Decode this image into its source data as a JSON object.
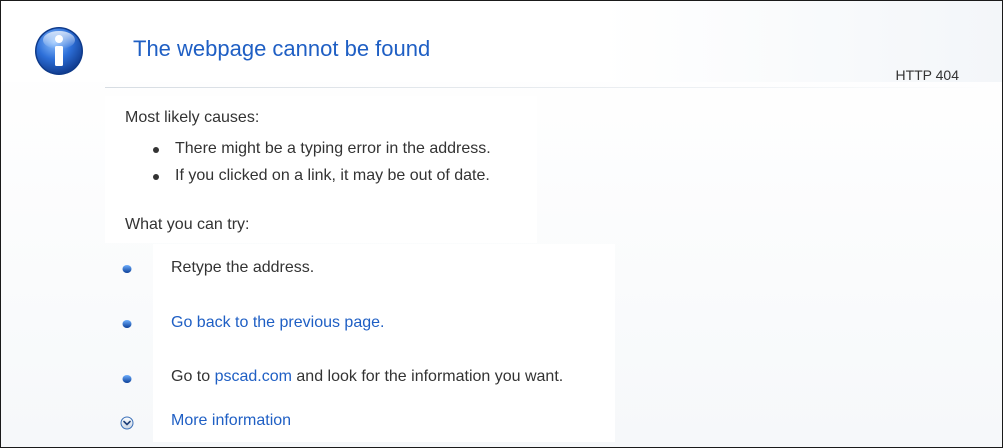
{
  "header": {
    "title": "The webpage cannot be found",
    "status_code": "HTTP 404"
  },
  "causes": {
    "heading": "Most likely causes:",
    "items": [
      "There might be a typing error in the address.",
      "If you clicked on a link, it may be out of date."
    ]
  },
  "try": {
    "heading": "What you can try:",
    "retype": "Retype the address.",
    "go_back_link": "Go back to the previous page.",
    "goto_prefix": "Go to ",
    "site_link": "pscad.com",
    "goto_suffix": " and look for the information you want.",
    "more_info": "More information"
  },
  "colors": {
    "link": "#1f5fc4",
    "text": "#333333",
    "icon_blue": "#2a6fd6"
  },
  "icons": {
    "header": "info-icon",
    "bullet": "blue-bullet-icon",
    "expand": "chevron-down-circle-icon"
  }
}
